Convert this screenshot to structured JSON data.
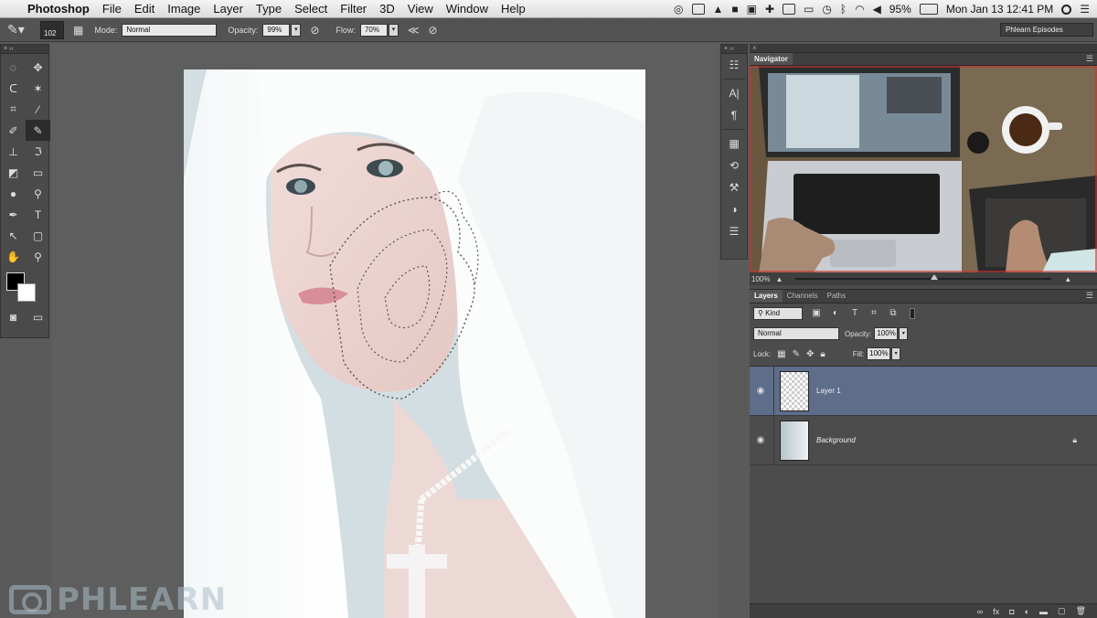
{
  "menubar": {
    "app_name": "Photoshop",
    "items": [
      "File",
      "Edit",
      "Image",
      "Layer",
      "Type",
      "Select",
      "Filter",
      "3D",
      "View",
      "Window",
      "Help"
    ],
    "battery": "95%",
    "date_time": "Mon Jan 13  12:41 PM"
  },
  "options": {
    "brush_size": "102",
    "mode_label": "Mode:",
    "mode_value": "Normal",
    "opacity_label": "Opacity:",
    "opacity_value": "99%",
    "flow_label": "Flow:",
    "flow_value": "70%",
    "workspace": "Phlearn Episodes"
  },
  "navigator": {
    "tab": "Navigator",
    "zoom": "100%"
  },
  "layers_panel": {
    "tabs": [
      "Layers",
      "Channels",
      "Paths"
    ],
    "kind_filter": "Kind",
    "blend_mode": "Normal",
    "opacity_label": "Opacity:",
    "opacity_value": "100%",
    "lock_label": "Lock:",
    "fill_label": "Fill:",
    "fill_value": "100%",
    "layers": [
      {
        "name": "Layer 1",
        "selected": true
      },
      {
        "name": "Background",
        "selected": false,
        "locked": true
      }
    ]
  },
  "watermark": {
    "text": "PHLEARN"
  }
}
